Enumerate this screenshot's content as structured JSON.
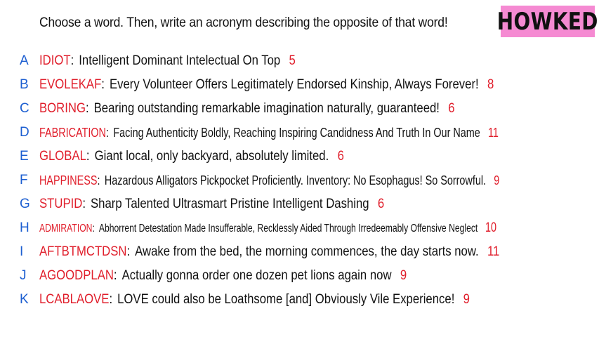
{
  "prompt": "Choose a word. Then, write an acronym describing the opposite of that word!",
  "brand": "HOWKED",
  "entries": [
    {
      "letter": "A",
      "word": "IDIOT",
      "acronym": "Intelligent Dominant Intelectual On Top",
      "count": "5"
    },
    {
      "letter": "B",
      "word": "EVOLEKAF",
      "acronym": "Every Volunteer Offers Legitimately Endorsed Kinship, Always Forever!",
      "count": "8"
    },
    {
      "letter": "C",
      "word": "BORING",
      "acronym": "Bearing outstanding remarkable imagination naturally, guaranteed!",
      "count": "6"
    },
    {
      "letter": "D",
      "word": "FABRICATION",
      "acronym": "Facing Authenticity Boldly, Reaching Inspiring Candidness And Truth In Our Name",
      "count": "11"
    },
    {
      "letter": "E",
      "word": "GLOBAL",
      "acronym": "Giant local, only backyard, absolutely limited.",
      "count": "6"
    },
    {
      "letter": "F",
      "word": "HAPPINESS",
      "acronym": "Hazardous Alligators Pickpocket Proficiently. Inventory: No Esophagus! So Sorrowful.",
      "count": "9"
    },
    {
      "letter": "G",
      "word": "STUPID",
      "acronym": "Sharp Talented Ultrasmart Pristine Intelligent Dashing",
      "count": "6"
    },
    {
      "letter": "H",
      "word": "ADMIRATION",
      "acronym": "Abhorrent Detestation Made Insufferable, Recklessly Aided Through Irredeemably Offensive Neglect",
      "count": "10"
    },
    {
      "letter": "I",
      "word": "AFTBTMCTDSN",
      "acronym": "Awake from the bed, the morning commences, the day starts now.",
      "count": "11"
    },
    {
      "letter": "J",
      "word": "AGOODPLAN",
      "acronym": "Actually gonna order one dozen pet lions again now",
      "count": "9"
    },
    {
      "letter": "K",
      "word": "LCABLAOVE",
      "acronym": "LOVE could also be Loathsome [and] Obviously Vile Experience!",
      "count": "9"
    }
  ]
}
